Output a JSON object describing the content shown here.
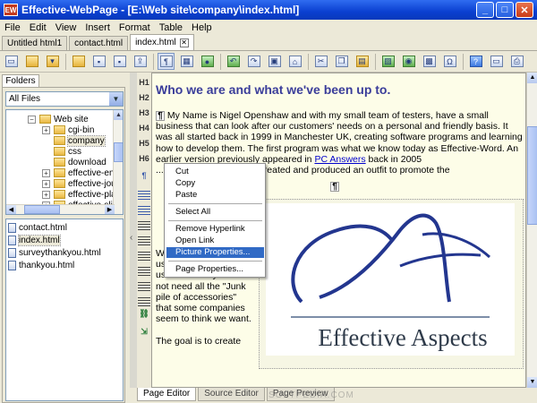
{
  "window": {
    "icon_text": "EW",
    "title": "Effective-WebPage - [E:\\Web site\\company\\index.html]",
    "min": "_",
    "max": "□",
    "close": "✕"
  },
  "menu": [
    "File",
    "Edit",
    "View",
    "Insert",
    "Format",
    "Table",
    "Help"
  ],
  "tabs": [
    {
      "label": "Untitled html1"
    },
    {
      "label": "contact.html"
    },
    {
      "label": "index.html",
      "close": "✕"
    }
  ],
  "toolbar_icons": [
    "new-document",
    "open-folder",
    "open-dropdown",
    "folder-up",
    "save",
    "save-all",
    "publish",
    "paragraph-marks",
    "table-grid",
    "link-globe",
    "undo",
    "redo",
    "image",
    "home",
    "cut",
    "copy",
    "paste",
    "image-insert",
    "color",
    "media",
    "special-char",
    "help",
    "preview",
    "print"
  ],
  "left_panel": {
    "tab": "Folders",
    "filter": "All Files",
    "tree": [
      {
        "label": "Web site",
        "expander": "−",
        "level": 0
      },
      {
        "label": "cgi-bin",
        "expander": "+",
        "level": 1
      },
      {
        "label": "company",
        "expander": "",
        "level": 1,
        "selected": true
      },
      {
        "label": "css",
        "expander": "",
        "level": 1
      },
      {
        "label": "download",
        "expander": "",
        "level": 1
      },
      {
        "label": "effective-engl",
        "expander": "+",
        "level": 1
      },
      {
        "label": "effective-journ",
        "expander": "+",
        "level": 1
      },
      {
        "label": "effective-plan",
        "expander": "+",
        "level": 1
      },
      {
        "label": "effective-slide",
        "expander": "+",
        "level": 1
      }
    ],
    "files": [
      {
        "label": "contact.html",
        "selected": false
      },
      {
        "label": "index.html",
        "selected": true
      },
      {
        "label": "surveythankyou.html",
        "selected": false
      },
      {
        "label": "thankyou.html",
        "selected": false
      }
    ],
    "collapse_arrow": "‹"
  },
  "format_toolbar": [
    "H1",
    "H2",
    "H3",
    "H4",
    "H5",
    "H6"
  ],
  "document": {
    "heading": "Who we are and what we've been up to.",
    "para1_prefix": "My Name is Nigel Openshaw and with my small team of testers, have a small business that can look after our customers' needs on a personal and friendly basis. It was all started back in 1999 in Manchester UK, creating software programs and learning how to develop them. The first program was what we know today as Effective-Word. An earlier version previously appeared in ",
    "para1_link": "PC Answers",
    "para1_suffix": " back in 2005",
    "para2": "...ters, I have now finally created and produced an outfit to promote the",
    "pilcrow": "¶",
    "red_hint": "W\nF",
    "left_col": "W... the student, home user, or small business user that really does not need all the \"Junk pile of accessories\" that some companies seem to think we want.",
    "goal": "The goal is to create",
    "logo_text": "Effective Aspects"
  },
  "context_menu": {
    "items": [
      {
        "label": "Cut"
      },
      {
        "label": "Copy"
      },
      {
        "label": "Paste"
      },
      {
        "label": "Select All"
      },
      {
        "label": "Remove Hyperlink"
      },
      {
        "label": "Open Link"
      },
      {
        "label": "Picture Properties...",
        "highlighted": true
      },
      {
        "label": "Page Properties..."
      }
    ]
  },
  "bottom_tabs": [
    {
      "label": "Page Editor",
      "active": true
    },
    {
      "label": "Source Editor",
      "active": false
    },
    {
      "label": "Page Preview",
      "active": false
    }
  ],
  "watermark": "SOFTPEDIA.COM"
}
